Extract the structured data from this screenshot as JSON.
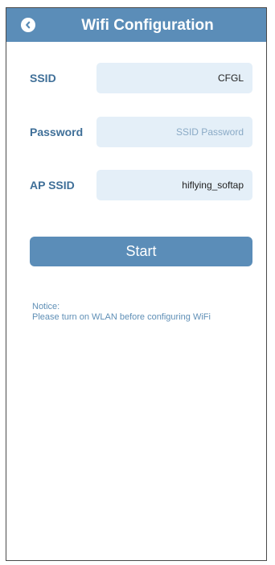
{
  "header": {
    "title": "Wifi Configuration",
    "back_icon": "chevron-left-circle-icon"
  },
  "form": {
    "ssid": {
      "label": "SSID",
      "value": "CFGL",
      "placeholder": ""
    },
    "password": {
      "label": "Password",
      "value": "",
      "placeholder": "SSID Password"
    },
    "ap_ssid": {
      "label": "AP SSID",
      "value": "hiflying_softap",
      "placeholder": ""
    }
  },
  "start_button": {
    "label": "Start"
  },
  "notice": {
    "title": "Notice:",
    "text": "Please turn on WLAN before configuring WiFi"
  },
  "colors": {
    "primary": "#5b8db8",
    "label": "#3f6f98",
    "field_bg": "#e4eff8",
    "notice": "#5f8fb6"
  }
}
